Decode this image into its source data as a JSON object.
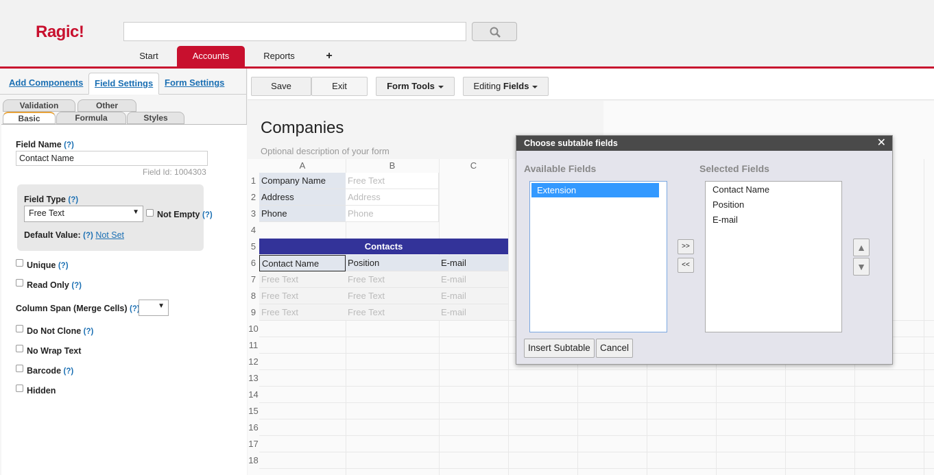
{
  "header": {
    "logo": "Ragic!",
    "search_value": "",
    "tabs": [
      {
        "label": "Start"
      },
      {
        "label": "Accounts"
      },
      {
        "label": "Reports"
      },
      {
        "label": "+"
      }
    ]
  },
  "left_panel": {
    "main_tabs": [
      "Add Components",
      "Field Settings",
      "Form Settings"
    ],
    "sub_tabs_top": [
      "Validation",
      "Other"
    ],
    "sub_tabs_bottom": [
      "Basic",
      "Formula",
      "Styles"
    ],
    "field_name_label": "Field Name",
    "help": "(?)",
    "field_name_value": "Contact Name",
    "field_id": "Field Id: 1004303",
    "field_type_label": "Field Type",
    "field_type_value": "Free Text",
    "not_empty": "Not Empty",
    "default_value_label": "Default Value:",
    "not_set": "Not Set",
    "unique": "Unique",
    "read_only": "Read Only",
    "column_span": "Column Span (Merge Cells)",
    "do_not_clone": "Do Not Clone",
    "no_wrap": "No Wrap Text",
    "barcode": "Barcode",
    "hidden": "Hidden"
  },
  "toolbar": {
    "save": "Save",
    "exit": "Exit",
    "form_tools": "Form Tools",
    "editing_prefix": "Editing",
    "editing_bold": "Fields"
  },
  "form": {
    "title": "Companies",
    "description": "Optional description of your form",
    "columns": [
      "A",
      "B",
      "C"
    ],
    "row_numbers": [
      "1",
      "2",
      "3",
      "4",
      "5",
      "6",
      "7",
      "8",
      "9",
      "10",
      "11",
      "12",
      "13",
      "14",
      "15",
      "16",
      "17",
      "18"
    ],
    "fields": [
      {
        "label": "Company Name",
        "placeholder": "Free Text"
      },
      {
        "label": "Address",
        "placeholder": "Address"
      },
      {
        "label": "Phone",
        "placeholder": "Phone"
      }
    ],
    "subtable_title": "Contacts",
    "subtable_headers": [
      "Contact Name",
      "Position",
      "E-mail"
    ],
    "subtable_placeholders": [
      "Free Text",
      "Free Text",
      "E-mail"
    ]
  },
  "dialog": {
    "title": "Choose subtable fields",
    "available_label": "Available Fields",
    "selected_label": "Selected Fields",
    "available": [
      "Extension"
    ],
    "selected": [
      "Contact Name",
      "Position",
      "E-mail"
    ],
    "move_right": ">>",
    "move_left": "<<",
    "insert": "Insert Subtable",
    "cancel": "Cancel"
  }
}
